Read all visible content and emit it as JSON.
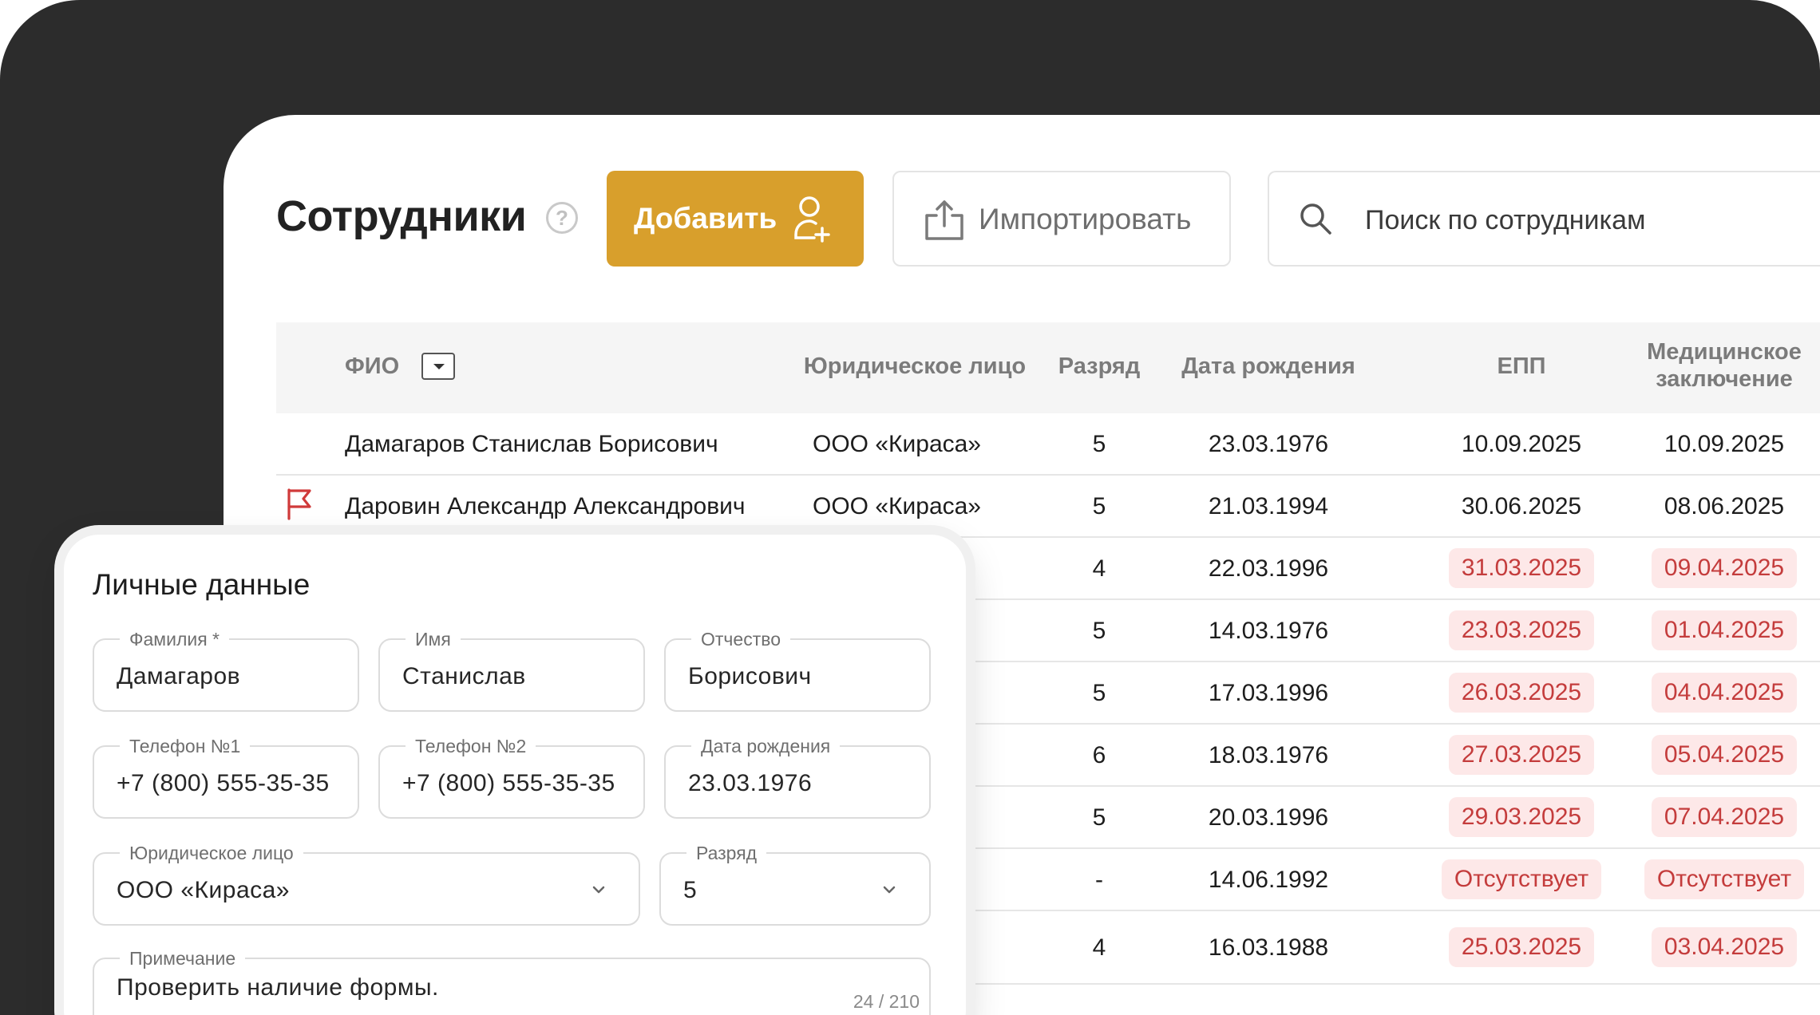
{
  "header": {
    "title": "Сотрудники",
    "help_icon": "question-circle-icon",
    "add_label": "Добавить",
    "import_label": "Импортировать",
    "search_placeholder": "Поиск по сотрудникам"
  },
  "colors": {
    "accent": "#d89f2c",
    "danger_text": "#c43c3c",
    "danger_bg": "#fde8e8",
    "backdrop": "#2c2c2c"
  },
  "table": {
    "columns": {
      "name": "ФИО",
      "org": "Юридическое лицо",
      "rank": "Разряд",
      "dob": "Дата рождения",
      "epp": "ЕПП",
      "med_line1": "Медицинское",
      "med_line2": "заключение"
    },
    "rows": [
      {
        "name": "Дамагаров Станислав Борисович",
        "org": "ООО «Кираса»",
        "rank": "5",
        "dob": "23.03.1976",
        "epp": "10.09.2025",
        "med": "10.09.2025",
        "epp_alert": false,
        "med_alert": false,
        "flag": false
      },
      {
        "name": "Даровин Александр Александрович",
        "org": "ООО «Кираса»",
        "rank": "5",
        "dob": "21.03.1994",
        "epp": "30.06.2025",
        "med": "08.06.2025",
        "epp_alert": false,
        "med_alert": false,
        "flag": true
      },
      {
        "name": "",
        "org": "",
        "rank": "4",
        "dob": "22.03.1996",
        "epp": "31.03.2025",
        "med": "09.04.2025",
        "epp_alert": true,
        "med_alert": true,
        "flag": false
      },
      {
        "name": "",
        "org": "",
        "rank": "5",
        "dob": "14.03.1976",
        "epp": "23.03.2025",
        "med": "01.04.2025",
        "epp_alert": true,
        "med_alert": true,
        "flag": false
      },
      {
        "name": "",
        "org": "",
        "rank": "5",
        "dob": "17.03.1996",
        "epp": "26.03.2025",
        "med": "04.04.2025",
        "epp_alert": true,
        "med_alert": true,
        "flag": false
      },
      {
        "name": "",
        "org": "",
        "rank": "6",
        "dob": "18.03.1976",
        "epp": "27.03.2025",
        "med": "05.04.2025",
        "epp_alert": true,
        "med_alert": true,
        "flag": false
      },
      {
        "name": "",
        "org": "",
        "rank": "5",
        "dob": "20.03.1996",
        "epp": "29.03.2025",
        "med": "07.04.2025",
        "epp_alert": true,
        "med_alert": true,
        "flag": false
      },
      {
        "name": "",
        "org": "",
        "rank": "-",
        "dob": "14.06.1992",
        "epp": "Отсутствует",
        "med": "Отсутствует",
        "epp_alert": true,
        "med_alert": true,
        "flag": false
      },
      {
        "name": "",
        "org": "",
        "rank": "4",
        "dob": "16.03.1988",
        "epp": "25.03.2025",
        "med": "03.04.2025",
        "epp_alert": true,
        "med_alert": true,
        "flag": false
      }
    ]
  },
  "form": {
    "title": "Личные данные",
    "last_name": {
      "label": "Фамилия *",
      "value": "Дамагаров"
    },
    "first_name": {
      "label": "Имя",
      "value": "Станислав"
    },
    "patronymic": {
      "label": "Отчество",
      "value": "Борисович"
    },
    "phone1": {
      "label": "Телефон №1",
      "value": "+7 (800) 555-35-35"
    },
    "phone2": {
      "label": "Телефон №2",
      "value": "+7 (800) 555-35-35"
    },
    "dob": {
      "label": "Дата рождения",
      "value": "23.03.1976"
    },
    "org": {
      "label": "Юридическое лицо",
      "value": "ООО «Кираса»"
    },
    "rank": {
      "label": "Разряд",
      "value": "5"
    },
    "note": {
      "label": "Примечание",
      "value": "Проверить наличие формы.",
      "counter": "24 / 210"
    }
  }
}
